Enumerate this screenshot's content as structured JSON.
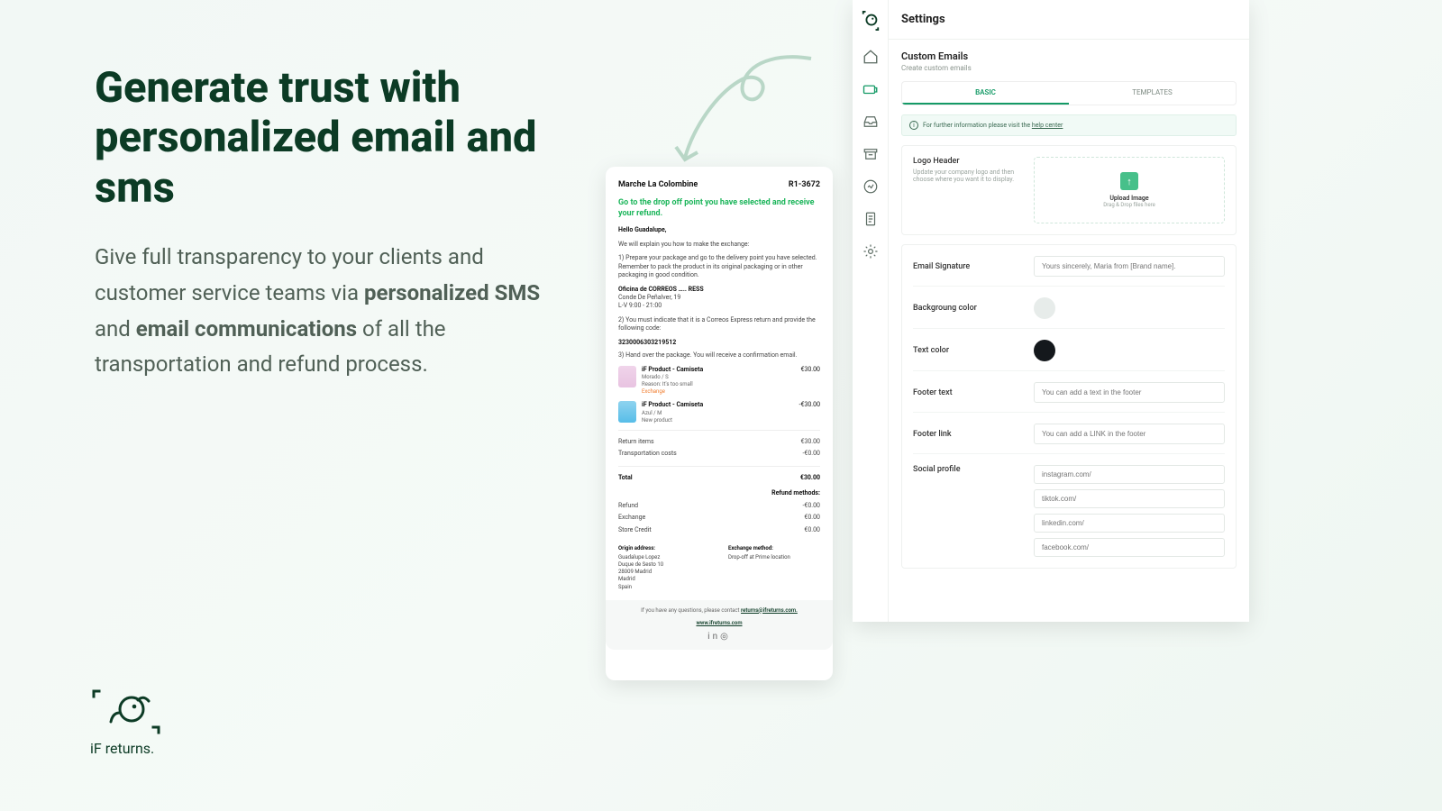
{
  "hero": {
    "title": "Generate trust with personalized email and sms",
    "body_pre": "Give full transparency to your clients and customer service teams via ",
    "body_bold1": "personalized SMS",
    "body_mid": " and ",
    "body_bold2": "email communications",
    "body_post": " of all the transportation and refund process."
  },
  "brand": {
    "name": "iF returns."
  },
  "email": {
    "merchant": "Marche La Colombine",
    "ref": "R1-3672",
    "title": "Go to the drop off point you have selected and receive your refund.",
    "greeting": "Hello Guadalupe,",
    "intro": "We will explain you how to make the exchange:",
    "step1": "1) Prepare your package and go to the delivery point you have selected. Remember to pack the product in its original packaging or in other packaging in good condition.",
    "office_name": "Oficina de CORREOS ….. RESS",
    "office_addr": "Conde De Peñalver, 19",
    "office_hours": "L-V 9:00 - 21:00",
    "step2": "2) You must indicate that it is a Correos Express return and provide the following code:",
    "code": "3230006303219512",
    "step3": "3) Hand over the package. You will receive a confirmation email.",
    "products": [
      {
        "name": "iF Product - Camiseta",
        "variant": "Morado / S",
        "reason": "Reason: It's too small",
        "tag": "Exchange",
        "price": "€30.00"
      },
      {
        "name": "iF Product - Camiseta",
        "variant": "Azul / M",
        "reason": "New product",
        "tag": "",
        "price": "-€30.00"
      }
    ],
    "summary": {
      "return_items_l": "Return items",
      "return_items_v": "€30.00",
      "transport_l": "Transportation costs",
      "transport_v": "-€0.00",
      "total_l": "Total",
      "total_v": "€30.00",
      "methods_l": "Refund methods:",
      "refund_l": "Refund",
      "refund_v": "-€0.00",
      "exchange_l": "Exchange",
      "exchange_v": "€0.00",
      "credit_l": "Store Credit",
      "credit_v": "€0.00"
    },
    "origin": {
      "hd": "Origin address:",
      "l1": "Guadalupe Lopez",
      "l2": "Duque de Sesto 10",
      "l3": "28009 Madrid",
      "l4": "Madrid",
      "l5": "Spain"
    },
    "method": {
      "hd": "Exchange method:",
      "val": "Drop-off at Prime location"
    },
    "footer": {
      "q": "If you have any questions, please contact ",
      "mail": "returns@ifreturns.com.",
      "site": "www.ifreturns.com"
    }
  },
  "settings": {
    "title": "Settings",
    "section_title": "Custom Emails",
    "section_sub": "Create custom emails",
    "tabs": {
      "basic": "BASIC",
      "templates": "TEMPLATES"
    },
    "info_pre": "For further information please visit the ",
    "info_link": "help center",
    "logo_header": "Logo Header",
    "logo_hint": "Update your company logo and then choose where you want it to display.",
    "upload_t1": "Upload Image",
    "upload_t2": "Drag & Drop files here",
    "sig_label": "Email Signature",
    "sig_placeholder": "Yours sincerely, Maria from [Brand name].",
    "bg_label": "Backgroung color",
    "txt_label": "Text color",
    "footer_text_label": "Footer text",
    "footer_text_placeholder": "You can add a text in the footer",
    "footer_link_label": "Footer link",
    "footer_link_placeholder": "You can add a LINK in the footer",
    "social_label": "Social profile",
    "social": [
      "instagram.com/",
      "tiktok.com/",
      "linkedin.com/",
      "facebook.com/"
    ]
  }
}
